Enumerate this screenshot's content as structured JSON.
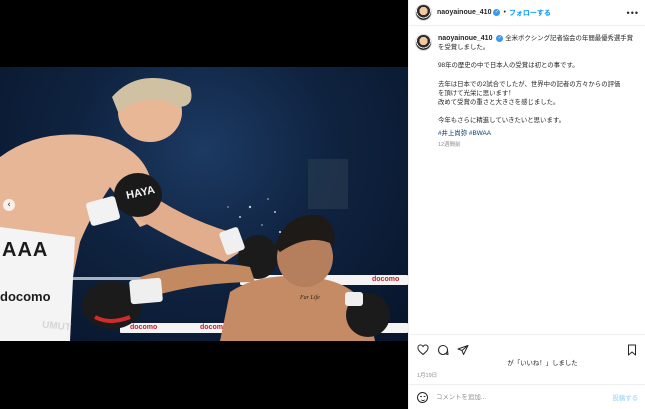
{
  "header": {
    "username": "naoyainoue_410",
    "separator": "•",
    "follow_label": "フォローする",
    "more_label": "•••"
  },
  "caption": {
    "username": "naoyainoue_410",
    "lines": [
      "全米ボクシング記者協会の年間最優秀選手賞",
      "を受賞しました。",
      "",
      "98年の歴史の中で日本人の受賞は初との事です。",
      "",
      "去年は日本での2試合でしたが、世界中の記者の方々からの評価",
      "を頂けて光栄に思います！",
      "改めて受賞の重さと大きさを感じました。",
      "",
      "今年もさらに精進していきたいと思います。"
    ],
    "hashtags": "#井上尚弥 #BWAA",
    "time_ago": "12週間前"
  },
  "photo": {
    "trunks_text_1": "AAA",
    "trunks_text_2": "docomo",
    "trunks_text_3": "UMUT",
    "glove_text": "HAYA",
    "tattoo_text": "Far Life",
    "banner_text": "docomo"
  },
  "media_nav": {
    "prev_label": "‹"
  },
  "likes_text": "が「いいね！」しました",
  "date_text": "1月19日",
  "comment": {
    "placeholder": "コメントを追加...",
    "post_label": "投稿する"
  },
  "colors": {
    "accent_blue": "#0095f6",
    "link_dark": "#00376b",
    "muted": "#8e8e8e"
  }
}
